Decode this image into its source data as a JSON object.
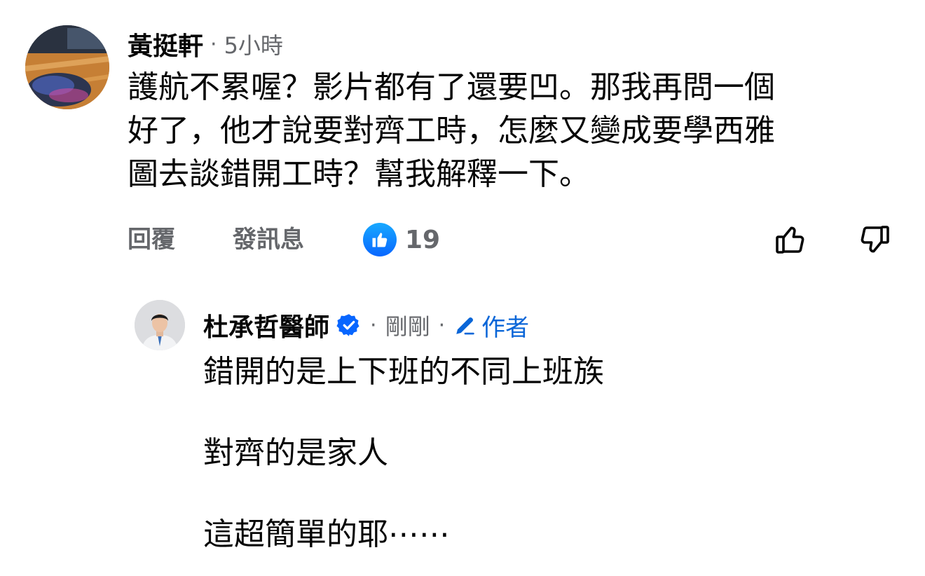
{
  "comment": {
    "author": "黃挺軒",
    "separator": "·",
    "time": "5小時",
    "lines": [
      "護航不累喔？影片都有了還要凹。那我再問一個",
      "好了，他才說要對齊工時，怎麼又變成要學西雅",
      "圖去談錯開工時？幫我解釋一下。"
    ],
    "actions": {
      "reply": "回覆",
      "message": "發訊息"
    },
    "like_count": "19",
    "icons": {
      "like_badge": "thumbs-up-icon",
      "upvote": "thumbs-up-outline-icon",
      "downvote": "thumbs-down-outline-icon"
    }
  },
  "reply": {
    "author": "杜承哲醫師",
    "verified_icon": "verified-badge-icon",
    "separator": "·",
    "time": "剛剛",
    "author_badge": "作者",
    "author_badge_icon": "pencil-icon",
    "paragraphs": [
      "錯開的是上下班的不同上班族",
      "對齊的是家人",
      "這超簡單的耶⋯⋯"
    ]
  },
  "colors": {
    "primary_text": "#050505",
    "secondary_text": "#65676b",
    "accent_blue": "#0866ff",
    "author_blue": "#0a66d8"
  }
}
